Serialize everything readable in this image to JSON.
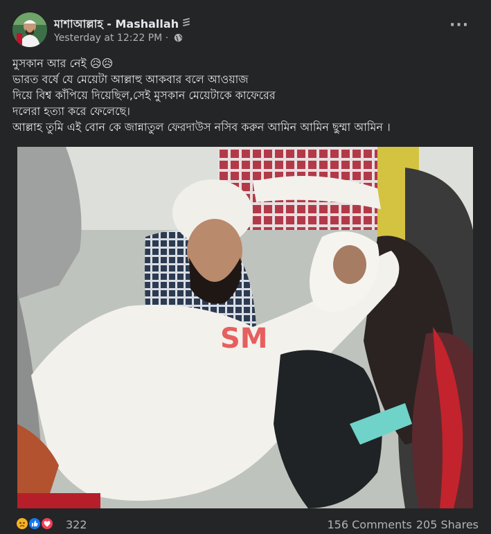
{
  "post": {
    "page_name": "মাশাআল্লাহ - Mashallah",
    "timestamp": "Yesterday at 12:22 PM",
    "separator": "·",
    "more_options": "···",
    "text_lines": [
      "মুসকান আর নেই 😥😥",
      "ভারত বর্ষে যে মেয়েটা আল্লাহু আকবার বলে আওয়াজ",
      "দিয়ে বিশ্ব কাঁপিয়ে দিয়েছিল,সেই মুসকান মেয়েটাকে কাফেরের",
      "দলেরা হত্যা করে ফেলেছে।",
      "আল্লাহ তুমি এই বোন কে জান্নাতুল ফেরদাউস নসিব করুন আমিন আমিন ছুম্মা আমিন ।"
    ],
    "photo_watermark": "SM"
  },
  "engagement": {
    "reaction_count": "322",
    "comments": "156 Comments",
    "shares": "205 Shares"
  },
  "colors": {
    "card_bg": "#242526",
    "page_bg": "#18191a",
    "primary_text": "#e4e6eb",
    "secondary_text": "#b0b3b8",
    "like_blue": "#1877f2",
    "love_red": "#f33e58",
    "sad_yellow": "#f7b125"
  },
  "icons": [
    "verified-badge-icon",
    "globe-icon",
    "more-options-icon",
    "sad-reaction-icon",
    "like-reaction-icon",
    "love-reaction-icon"
  ]
}
